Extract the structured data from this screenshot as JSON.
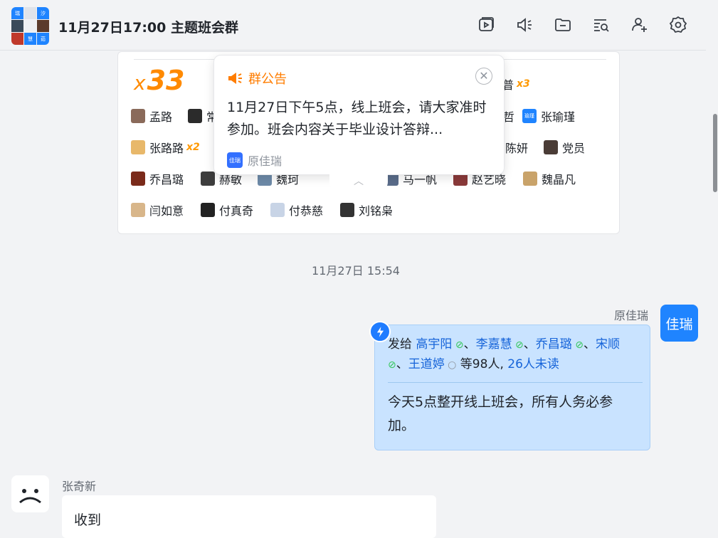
{
  "header": {
    "title": "11月27日17:00 主题班会群",
    "avatar_tiles": [
      "瑞",
      "",
      "汐",
      "",
      "",
      "",
      "",
      "慧",
      "茹"
    ]
  },
  "toolbar": {
    "icons": [
      "video-icon",
      "announcement-icon",
      "folder-icon",
      "search-history-icon",
      "add-member-icon",
      "settings-icon"
    ]
  },
  "read_card": {
    "count_prefix": "x",
    "count": "33",
    "readers": [
      {
        "name": "普",
        "mult": "x3"
      },
      {
        "name": "孟路"
      },
      {
        "name": "常"
      },
      {
        "name": "哲"
      },
      {
        "name": "张瑜瑾",
        "avatar_text": "瑜瑾"
      },
      {
        "name": "张路路",
        "mult": "x2"
      },
      {
        "name": "陈妍"
      },
      {
        "name": "党员"
      },
      {
        "name": "乔昌璐"
      },
      {
        "name": "赫敏"
      },
      {
        "name": "魏珂"
      },
      {
        "name": "马一帆"
      },
      {
        "name": "赵艺晓"
      },
      {
        "name": "魏晶凡"
      },
      {
        "name": "闫如意"
      },
      {
        "name": "付真奇"
      },
      {
        "name": "付恭慈"
      },
      {
        "name": "刘铭枭"
      }
    ]
  },
  "notice": {
    "heading": "群公告",
    "body": "11月27日下午5点，线上班会，请大家准时参加。班会内容关于毕业设计答辩...",
    "author": "原佳瑞",
    "author_avatar": "佳瑞"
  },
  "timeline": {
    "timestamp": "11月27日 15:54"
  },
  "outgoing": {
    "sender": "原佳瑞",
    "avatar_text": "佳瑞",
    "send_prefix": "发给 ",
    "recipients_read": [
      "高宇阳",
      "李嘉慧",
      "乔昌璐",
      "宋顺"
    ],
    "recipient_pending": "王道婷",
    "others": " 等98人, ",
    "unread": "26人未读",
    "text": "今天5点整开线上班会，所有人务必参加。"
  },
  "incoming": {
    "sender": "张奇新",
    "text": "收到"
  }
}
